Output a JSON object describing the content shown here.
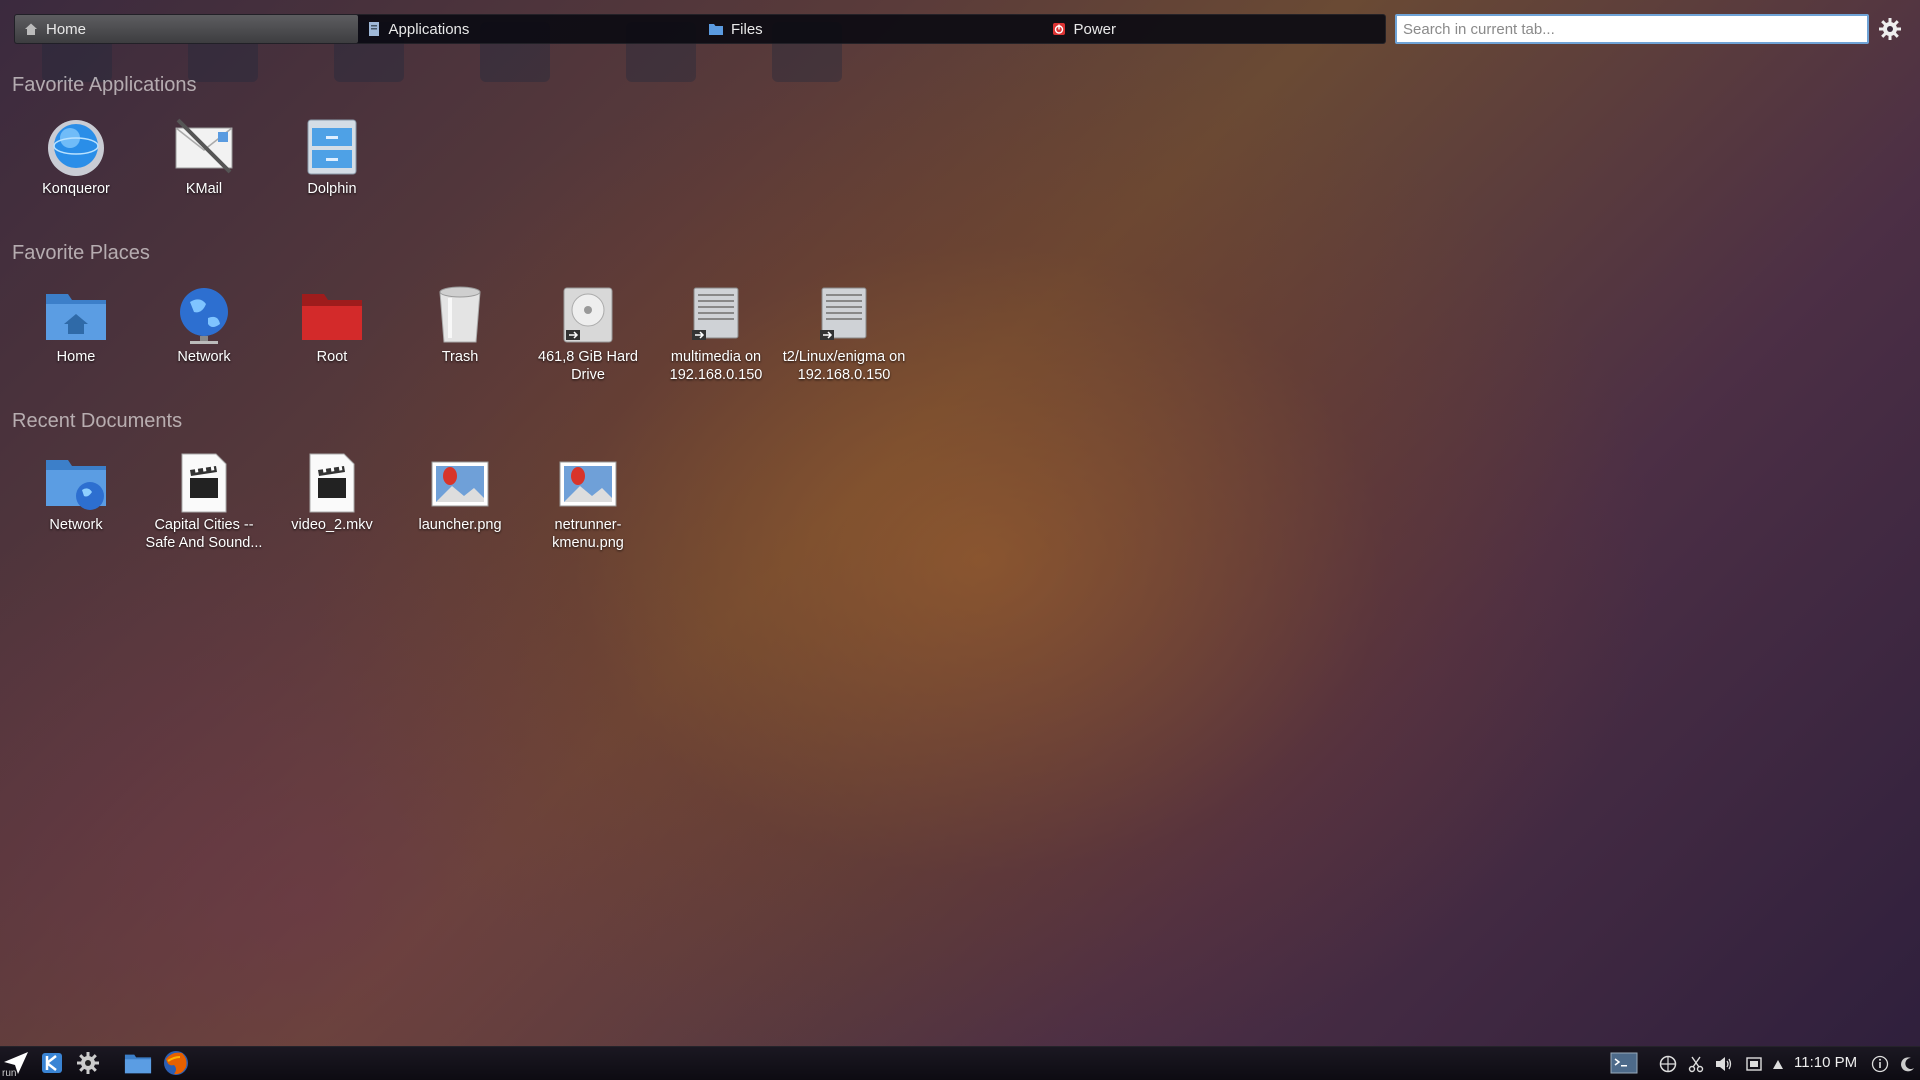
{
  "tabs": [
    {
      "label": "Home",
      "icon": "home-icon"
    },
    {
      "label": "Applications",
      "icon": "applications-icon"
    },
    {
      "label": "Files",
      "icon": "folder-icon"
    },
    {
      "label": "Power",
      "icon": "power-icon"
    }
  ],
  "search": {
    "placeholder": "Search in current tab..."
  },
  "sections": {
    "favorite_applications": {
      "title": "Favorite Applications",
      "items": [
        {
          "label": "Konqueror",
          "icon": "konqueror-icon"
        },
        {
          "label": "KMail",
          "icon": "kmail-icon"
        },
        {
          "label": "Dolphin",
          "icon": "dolphin-icon"
        }
      ]
    },
    "favorite_places": {
      "title": "Favorite Places",
      "items": [
        {
          "label": "Home",
          "icon": "home-folder-icon"
        },
        {
          "label": "Network",
          "icon": "network-globe-icon"
        },
        {
          "label": "Root",
          "icon": "root-folder-icon"
        },
        {
          "label": "Trash",
          "icon": "trash-icon"
        },
        {
          "label": "461,8 GiB Hard Drive",
          "icon": "hard-drive-icon"
        },
        {
          "label": "multimedia on 192.168.0.150",
          "icon": "network-server-icon"
        },
        {
          "label": "t2/Linux/enigma on 192.168.0.150",
          "icon": "network-server-icon"
        }
      ]
    },
    "recent_documents": {
      "title": "Recent Documents",
      "items": [
        {
          "label": "Network",
          "icon": "network-folder-icon"
        },
        {
          "label": "Capital Cities -- Safe And Sound...",
          "icon": "video-file-icon"
        },
        {
          "label": "video_2.mkv",
          "icon": "video-file-icon"
        },
        {
          "label": "launcher.png",
          "icon": "image-file-icon"
        },
        {
          "label": "netrunner-kmenu.png",
          "icon": "image-file-icon"
        }
      ]
    }
  },
  "taskbar": {
    "run_label": "run",
    "clock": "11:10 PM"
  },
  "colors": {
    "search_border": "#6fa3d6",
    "root_folder": "#d32a2a",
    "folder_blue": "#4d8fd6"
  }
}
